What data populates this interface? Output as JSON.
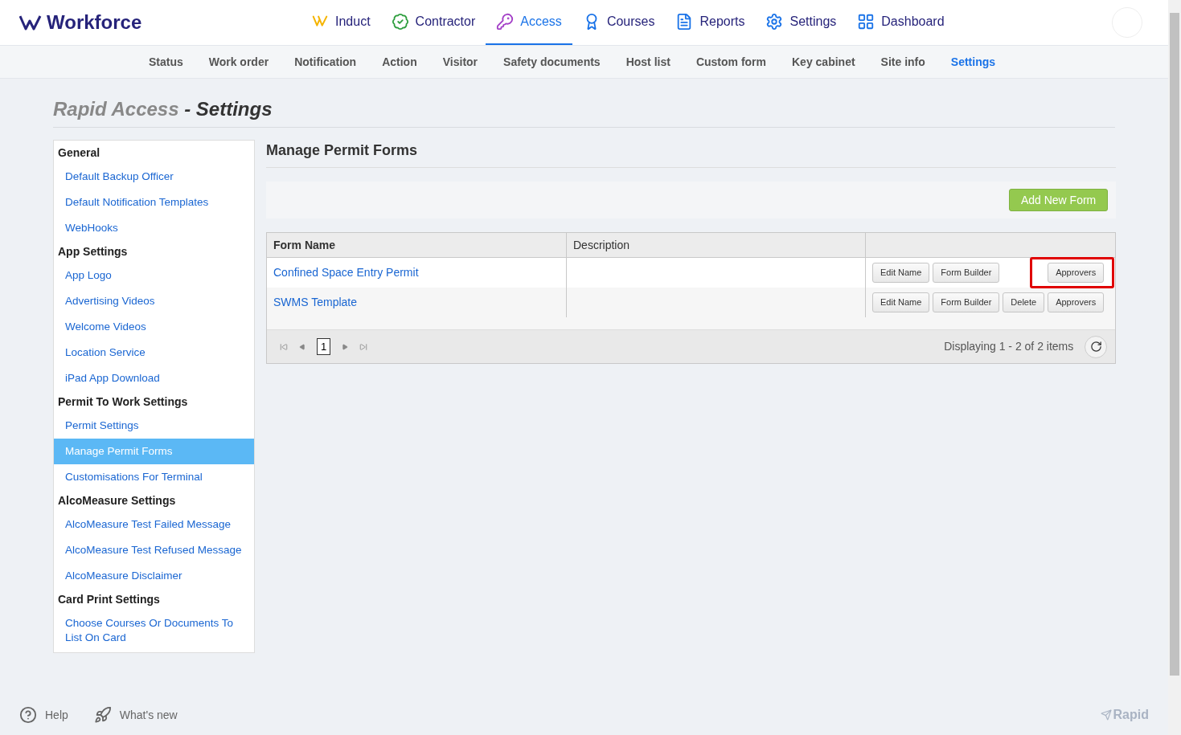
{
  "brand": "Workforce",
  "nav": [
    {
      "label": "Induct",
      "selected": false
    },
    {
      "label": "Contractor",
      "selected": false
    },
    {
      "label": "Access",
      "selected": true
    },
    {
      "label": "Courses",
      "selected": false
    },
    {
      "label": "Reports",
      "selected": false
    },
    {
      "label": "Settings",
      "selected": false
    },
    {
      "label": "Dashboard",
      "selected": false
    }
  ],
  "subnav": [
    {
      "label": "Status",
      "selected": false
    },
    {
      "label": "Work order",
      "selected": false
    },
    {
      "label": "Notification",
      "selected": false
    },
    {
      "label": "Action",
      "selected": false
    },
    {
      "label": "Visitor",
      "selected": false
    },
    {
      "label": "Safety documents",
      "selected": false
    },
    {
      "label": "Host list",
      "selected": false
    },
    {
      "label": "Custom form",
      "selected": false
    },
    {
      "label": "Key cabinet",
      "selected": false
    },
    {
      "label": "Site info",
      "selected": false
    },
    {
      "label": "Settings",
      "selected": true
    }
  ],
  "page_title": {
    "module": "Rapid Access",
    "separator": "-",
    "page": "Settings"
  },
  "sidebar": [
    {
      "heading": "General",
      "items": [
        {
          "label": "Default Backup Officer",
          "selected": false
        },
        {
          "label": "Default Notification Templates",
          "selected": false
        },
        {
          "label": "WebHooks",
          "selected": false
        }
      ]
    },
    {
      "heading": "App Settings",
      "items": [
        {
          "label": "App Logo",
          "selected": false
        },
        {
          "label": "Advertising Videos",
          "selected": false
        },
        {
          "label": "Welcome Videos",
          "selected": false
        },
        {
          "label": "Location Service",
          "selected": false
        },
        {
          "label": "iPad App Download",
          "selected": false
        }
      ]
    },
    {
      "heading": "Permit To Work Settings",
      "items": [
        {
          "label": "Permit Settings",
          "selected": false
        },
        {
          "label": "Manage Permit Forms",
          "selected": true
        },
        {
          "label": "Customisations For Terminal",
          "selected": false
        }
      ]
    },
    {
      "heading": "AlcoMeasure Settings",
      "items": [
        {
          "label": "AlcoMeasure Test Failed Message",
          "selected": false
        },
        {
          "label": "AlcoMeasure Test Refused Message",
          "selected": false
        },
        {
          "label": "AlcoMeasure Disclaimer",
          "selected": false
        }
      ]
    },
    {
      "heading": "Card Print Settings",
      "items": [
        {
          "label": "Choose Courses Or Documents To List On Card",
          "selected": false
        }
      ]
    }
  ],
  "section_title": "Manage Permit Forms",
  "add_button": "Add New Form",
  "table": {
    "columns": [
      "Form Name",
      "Description"
    ],
    "rows": [
      {
        "name": "Confined Space Entry Permit",
        "actions": [
          {
            "label": "Edit Name",
            "highlighted": false
          },
          {
            "label": "Form Builder",
            "highlighted": false
          },
          {
            "label": "Approvers",
            "highlighted": true
          }
        ]
      },
      {
        "name": "SWMS Template",
        "actions": [
          {
            "label": "Edit Name",
            "highlighted": false
          },
          {
            "label": "Form Builder",
            "highlighted": false
          },
          {
            "label": "Delete",
            "highlighted": false
          },
          {
            "label": "Approvers",
            "highlighted": false
          }
        ]
      }
    ]
  },
  "pager": {
    "pages": [
      {
        "label": "1",
        "selected": true
      }
    ],
    "summary": "Displaying 1 - 2 of 2 items"
  },
  "footer": {
    "help": "Help",
    "whats_new": "What's new",
    "logo": "Rapid"
  }
}
